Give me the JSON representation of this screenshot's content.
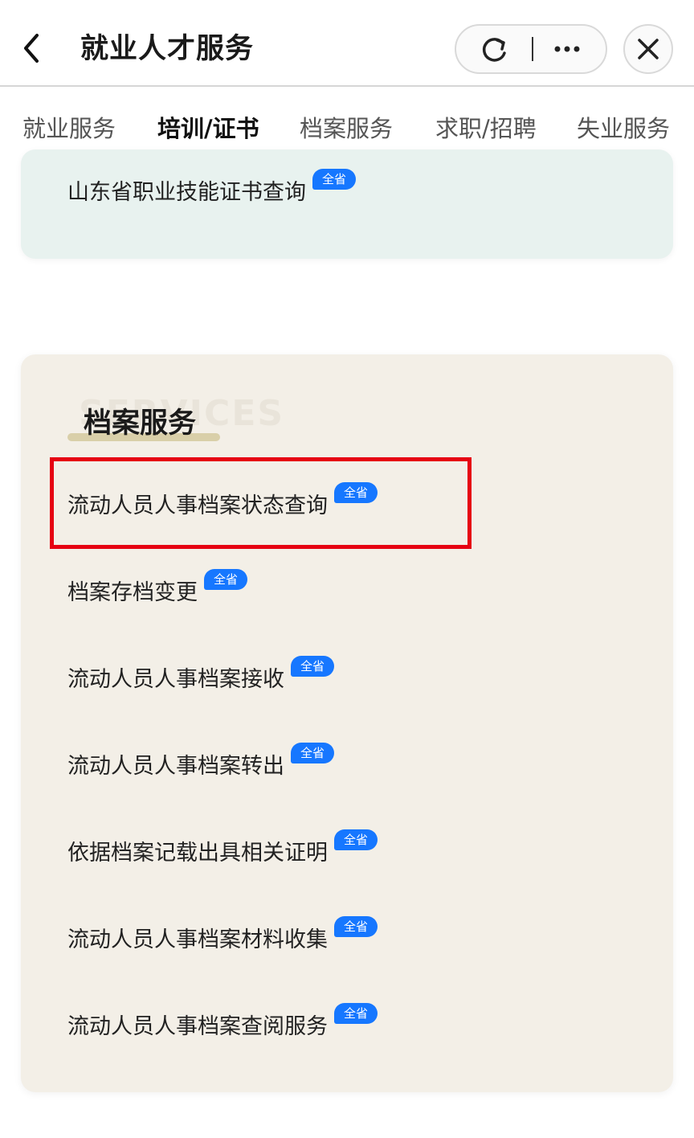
{
  "header": {
    "title": "就业人才服务",
    "back_icon": "chevron-left-icon",
    "refresh_icon": "refresh-icon",
    "more_icon": "more-dots-icon",
    "close_icon": "close-icon"
  },
  "tabs": [
    {
      "label": "就业服务",
      "active": false
    },
    {
      "label": "培训/证书",
      "active": true
    },
    {
      "label": "档案服务",
      "active": false
    },
    {
      "label": "求职/招聘",
      "active": false
    },
    {
      "label": "失业服务",
      "active": false
    }
  ],
  "top_card": {
    "items": [
      {
        "label": "山东省职业技能证书查询",
        "badge": "全省"
      }
    ]
  },
  "archive_section": {
    "title": "档案服务",
    "watermark": "SERVICES",
    "items": [
      {
        "label": "流动人员人事档案状态查询",
        "badge": "全省"
      },
      {
        "label": "档案存档变更",
        "badge": "全省"
      },
      {
        "label": "流动人员人事档案接收",
        "badge": "全省"
      },
      {
        "label": "流动人员人事档案转出",
        "badge": "全省"
      },
      {
        "label": "依据档案记载出具相关证明",
        "badge": "全省"
      },
      {
        "label": "流动人员人事档案材料收集",
        "badge": "全省"
      },
      {
        "label": "流动人员人事档案查阅服务",
        "badge": "全省"
      }
    ]
  },
  "colors": {
    "accent": "#1677ff",
    "highlight": "#e60012",
    "top_card_bg": "#e8f2ef",
    "main_card_bg": "#f3efe7"
  }
}
